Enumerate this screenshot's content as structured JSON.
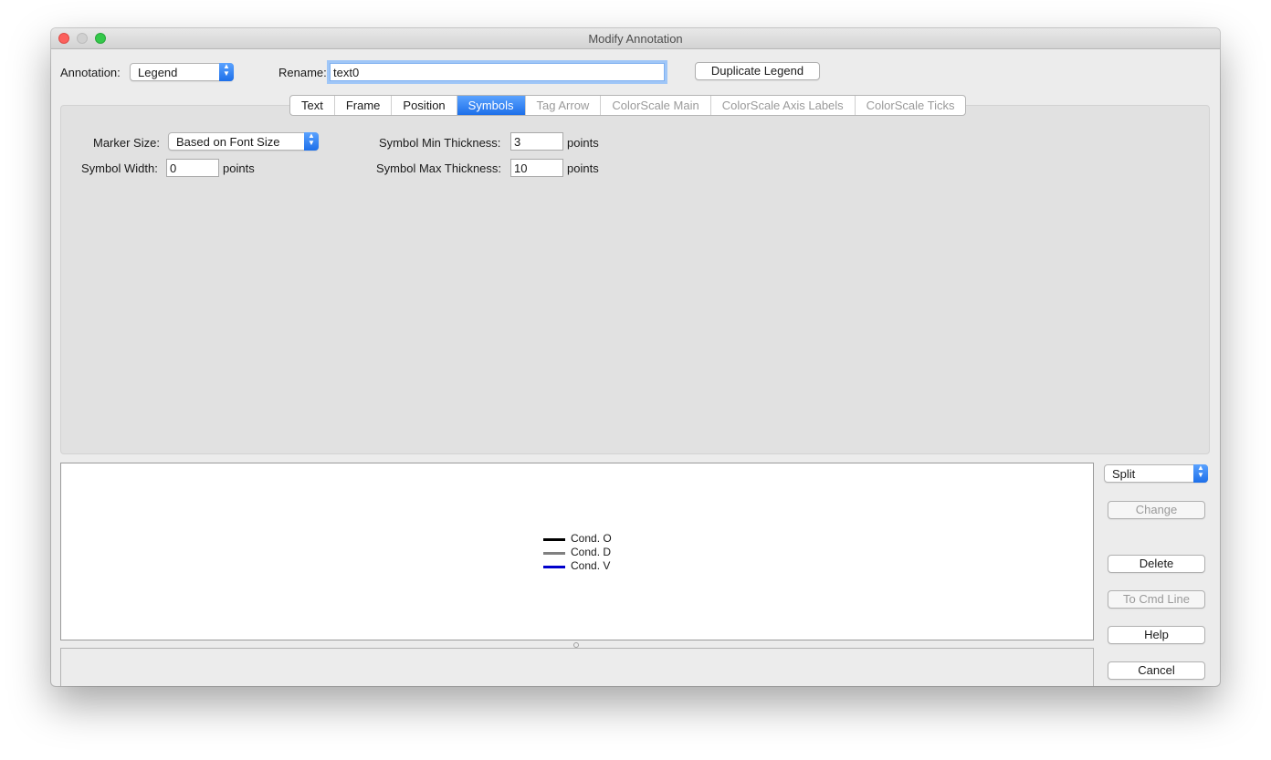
{
  "window": {
    "title": "Modify Annotation"
  },
  "annotation": {
    "label": "Annotation:",
    "value": "Legend"
  },
  "rename": {
    "label": "Rename:",
    "value": "text0"
  },
  "duplicate_button": "Duplicate Legend",
  "tabs": [
    {
      "label": "Text",
      "state": "enabled"
    },
    {
      "label": "Frame",
      "state": "enabled"
    },
    {
      "label": "Position",
      "state": "enabled"
    },
    {
      "label": "Symbols",
      "state": "active"
    },
    {
      "label": "Tag Arrow",
      "state": "disabled"
    },
    {
      "label": "ColorScale Main",
      "state": "disabled"
    },
    {
      "label": "ColorScale Axis Labels",
      "state": "disabled"
    },
    {
      "label": "ColorScale Ticks",
      "state": "disabled"
    }
  ],
  "symbols": {
    "marker_size_label": "Marker Size:",
    "marker_size_value": "Based on Font Size",
    "symbol_width_label": "Symbol Width:",
    "symbol_width_value": "0",
    "symbol_width_unit": "points",
    "min_thickness_label": "Symbol Min Thickness:",
    "min_thickness_value": "3",
    "min_thickness_unit": "points",
    "max_thickness_label": "Symbol Max Thickness:",
    "max_thickness_value": "10",
    "max_thickness_unit": "points"
  },
  "preview": {
    "legend": [
      {
        "label": "Cond. O",
        "color": "#000000"
      },
      {
        "label": "Cond. D",
        "color": "#808080"
      },
      {
        "label": "Cond. V",
        "color": "#0000cc"
      }
    ]
  },
  "side": {
    "mode_value": "Split",
    "change": "Change",
    "delete": "Delete",
    "to_cmd_line": "To Cmd Line",
    "help": "Help",
    "cancel": "Cancel"
  }
}
